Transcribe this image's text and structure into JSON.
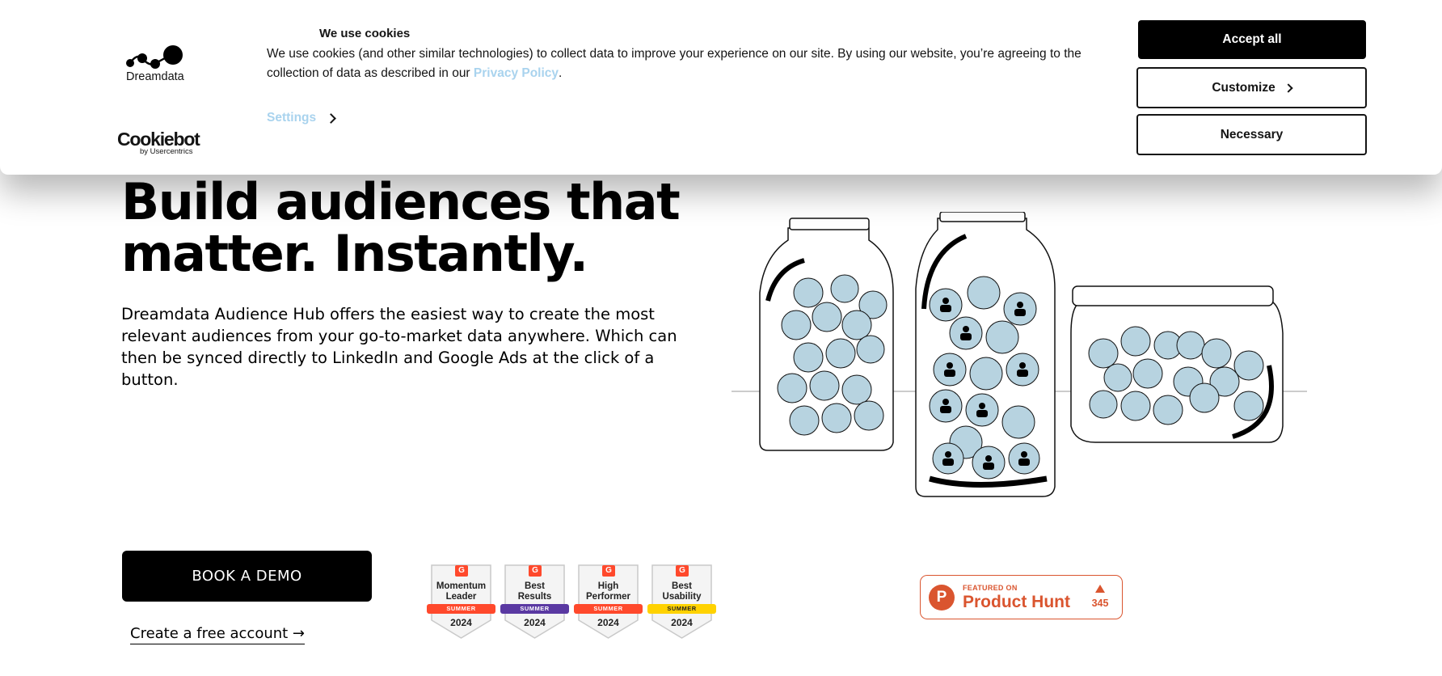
{
  "hero": {
    "title": "Build audiences that matter. Instantly.",
    "description": "Dreamdata Audience Hub offers the easiest way to create the most relevant audiences from your go-to-market data anywhere. Which can then be synced directly to LinkedIn and Google Ads at the click of a button.",
    "demo_button": "BOOK A DEMO",
    "free_account_link": "Create a free account →"
  },
  "badges": [
    {
      "title": "Momentum Leader",
      "season": "SUMMER",
      "year": "2024",
      "color": "#ff492c",
      "g2": "G"
    },
    {
      "title": "Best Results",
      "season": "SUMMER",
      "year": "2024",
      "color": "#5a39a2",
      "g2": "G"
    },
    {
      "title": "High Performer",
      "season": "SUMMER",
      "year": "2024",
      "color": "#ff492c",
      "g2": "G"
    },
    {
      "title": "Best Usability",
      "season": "SUMMER",
      "year": "2024",
      "color": "#ffd200",
      "g2": "G"
    }
  ],
  "product_hunt": {
    "featured": "FEATURED ON",
    "name": "Product Hunt",
    "votes": "345",
    "logo_letter": "P",
    "color": "#da552f"
  },
  "cookie_banner": {
    "brand": "Dreamdata",
    "cookiebot": "Cookiebot",
    "cookiebot_sub": "by Usercentrics",
    "title": "We use cookies",
    "text_before": "We use cookies (and other similar technologies) to collect data to improve your experience on our site. By using our website, you’re agreeing to the collection of data as described in our ",
    "privacy_link": "Privacy Policy",
    "text_after": ".",
    "settings_label": "Settings",
    "accept_all": "Accept all",
    "customize": "Customize",
    "necessary": "Necessary"
  }
}
